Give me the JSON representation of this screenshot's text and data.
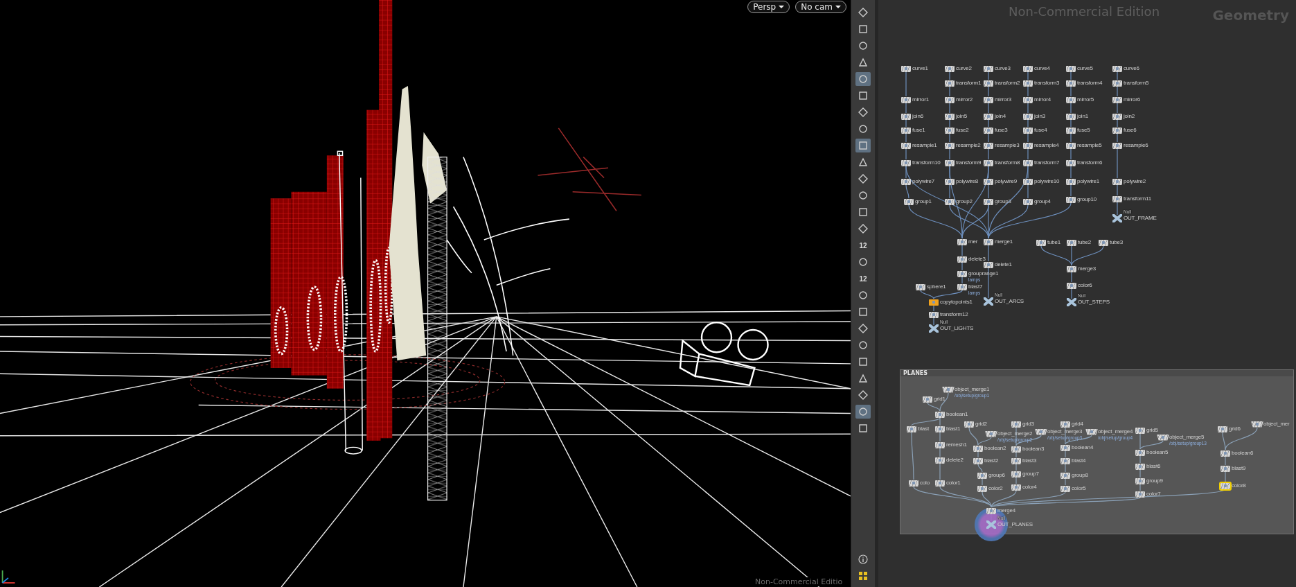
{
  "viewport": {
    "view_menu": "Persp",
    "camera_menu": "No cam",
    "edition_label": "Non-Commercial Editio"
  },
  "toolbar": {
    "tools": [
      {
        "selected": false
      },
      {
        "selected": false
      },
      {
        "selected": false
      },
      {
        "selected": false
      },
      {
        "selected": true
      },
      {
        "selected": false
      },
      {
        "selected": false
      },
      {
        "selected": false
      },
      {
        "selected": true
      },
      {
        "selected": false
      },
      {
        "selected": false
      },
      {
        "selected": false
      },
      {
        "selected": false
      },
      {
        "selected": false
      },
      {
        "selected": false,
        "label": "12"
      },
      {
        "selected": false
      },
      {
        "selected": false,
        "label": "12"
      },
      {
        "selected": false
      },
      {
        "selected": false
      },
      {
        "selected": false
      },
      {
        "selected": false
      },
      {
        "selected": false
      },
      {
        "selected": false
      },
      {
        "selected": false
      },
      {
        "selected": true
      },
      {
        "selected": false
      }
    ],
    "footer_tools": [
      {
        "selected": false
      },
      {
        "selected": false
      }
    ]
  },
  "network": {
    "edition_label": "Non-Commercial Edition",
    "context_label": "Geometry",
    "nodes": [
      {
        "label": "curve1",
        "kind": "sop",
        "selected": false,
        "display": false
      },
      {
        "label": "curve2",
        "kind": "sop",
        "selected": false,
        "display": false
      },
      {
        "label": "curve3",
        "kind": "sop",
        "selected": false,
        "display": false
      },
      {
        "label": "curve4",
        "kind": "sop",
        "selected": false,
        "display": false
      },
      {
        "label": "curve5",
        "kind": "sop",
        "selected": false,
        "display": false
      },
      {
        "label": "curve6",
        "kind": "sop",
        "selected": false,
        "display": false
      },
      {
        "label": "transform1",
        "kind": "sop",
        "selected": false,
        "display": false
      },
      {
        "label": "transform2",
        "kind": "sop",
        "selected": false,
        "display": false
      },
      {
        "label": "transform3",
        "kind": "sop",
        "selected": false,
        "display": false
      },
      {
        "label": "transform4",
        "kind": "sop",
        "selected": false,
        "display": false
      },
      {
        "label": "transform5",
        "kind": "sop",
        "selected": false,
        "display": false
      },
      {
        "label": "mirror1",
        "kind": "sop",
        "selected": false,
        "display": false
      },
      {
        "label": "mirror2",
        "kind": "sop",
        "selected": false,
        "display": false
      },
      {
        "label": "mirror3",
        "kind": "sop",
        "selected": false,
        "display": false
      },
      {
        "label": "mirror4",
        "kind": "sop",
        "selected": false,
        "display": false
      },
      {
        "label": "mirror5",
        "kind": "sop",
        "selected": false,
        "display": false
      },
      {
        "label": "mirror6",
        "kind": "sop",
        "selected": false,
        "display": false
      },
      {
        "label": "join6",
        "kind": "sop",
        "selected": false,
        "display": false
      },
      {
        "label": "join5",
        "kind": "sop",
        "selected": false,
        "display": false
      },
      {
        "label": "join4",
        "kind": "sop",
        "selected": false,
        "display": false
      },
      {
        "label": "join3",
        "kind": "sop",
        "selected": false,
        "display": false
      },
      {
        "label": "join1",
        "kind": "sop",
        "selected": false,
        "display": false
      },
      {
        "label": "join2",
        "kind": "sop",
        "selected": false,
        "display": false
      },
      {
        "label": "fuse1",
        "kind": "sop",
        "selected": false,
        "display": false
      },
      {
        "label": "fuse2",
        "kind": "sop",
        "selected": false,
        "display": false
      },
      {
        "label": "fuse3",
        "kind": "sop",
        "selected": false,
        "display": false
      },
      {
        "label": "fuse4",
        "kind": "sop",
        "selected": false,
        "display": false
      },
      {
        "label": "fuse5",
        "kind": "sop",
        "selected": false,
        "display": false
      },
      {
        "label": "fuse6",
        "kind": "sop",
        "selected": false,
        "display": false
      },
      {
        "label": "resample1",
        "kind": "sop",
        "selected": false,
        "display": false
      },
      {
        "label": "resample2",
        "kind": "sop",
        "selected": false,
        "display": false
      },
      {
        "label": "resample3",
        "kind": "sop",
        "selected": false,
        "display": false
      },
      {
        "label": "resample4",
        "kind": "sop",
        "selected": false,
        "display": false
      },
      {
        "label": "resample5",
        "kind": "sop",
        "selected": false,
        "display": false
      },
      {
        "label": "resample6",
        "kind": "sop",
        "selected": false,
        "display": false
      },
      {
        "label": "transform10",
        "kind": "sop",
        "selected": false,
        "display": false
      },
      {
        "label": "transform9",
        "kind": "sop",
        "selected": false,
        "display": false
      },
      {
        "label": "transform8",
        "kind": "sop",
        "selected": false,
        "display": false
      },
      {
        "label": "transform7",
        "kind": "sop",
        "selected": false,
        "display": false
      },
      {
        "label": "transform6",
        "kind": "sop",
        "selected": false,
        "display": false
      },
      {
        "label": "polywire7",
        "kind": "sop",
        "selected": false,
        "display": false
      },
      {
        "label": "polywire8",
        "kind": "sop",
        "selected": false,
        "display": false
      },
      {
        "label": "polywire9",
        "kind": "sop",
        "selected": false,
        "display": false
      },
      {
        "label": "polywire10",
        "kind": "sop",
        "selected": false,
        "display": false
      },
      {
        "label": "polywire1",
        "kind": "sop",
        "selected": false,
        "display": false
      },
      {
        "label": "polywire2",
        "kind": "sop",
        "selected": false,
        "display": false
      },
      {
        "label": "group1",
        "kind": "sop",
        "selected": false,
        "display": false
      },
      {
        "label": "group2",
        "kind": "sop",
        "selected": false,
        "display": false
      },
      {
        "label": "group3",
        "kind": "sop",
        "selected": false,
        "display": false
      },
      {
        "label": "group4",
        "kind": "sop",
        "selected": false,
        "display": false
      },
      {
        "label": "group10",
        "kind": "sop",
        "selected": false,
        "display": false
      },
      {
        "label": "transform11",
        "kind": "sop",
        "selected": false,
        "display": false
      },
      {
        "label": "OUT_FRAME",
        "kind": "null",
        "type_label": "Null",
        "selected": false,
        "display": false
      },
      {
        "label": "mer",
        "kind": "sop",
        "selected": false,
        "display": false
      },
      {
        "label": "merge1",
        "kind": "sop",
        "selected": false,
        "display": false
      },
      {
        "label": "delete3",
        "kind": "sop",
        "selected": false,
        "display": false
      },
      {
        "label": "delete1",
        "kind": "sop",
        "selected": false,
        "display": false
      },
      {
        "label": "grouprange1",
        "kind": "sop",
        "sublabel": "lamps",
        "selected": false,
        "display": false
      },
      {
        "label": "sphere1",
        "kind": "sop",
        "selected": false,
        "display": false
      },
      {
        "label": "blast7",
        "kind": "sop",
        "sublabel": "lamps",
        "selected": false,
        "display": false
      },
      {
        "label": "copytopoints1",
        "kind": "sop",
        "color": "#f0a21e",
        "selected": false,
        "display": false
      },
      {
        "label": "transform12",
        "kind": "sop",
        "selected": false,
        "display": false
      },
      {
        "label": "OUT_LIGHTS",
        "kind": "null",
        "type_label": "Null",
        "selected": false,
        "display": false
      },
      {
        "label": "OUT_ARCS",
        "kind": "null",
        "type_label": "Null",
        "selected": false,
        "display": false
      },
      {
        "label": "tube1",
        "kind": "sop",
        "selected": false,
        "display": false
      },
      {
        "label": "tube2",
        "kind": "sop",
        "selected": false,
        "display": false
      },
      {
        "label": "tube3",
        "kind": "sop",
        "selected": false,
        "display": false
      },
      {
        "label": "merge3",
        "kind": "sop",
        "selected": false,
        "display": false
      },
      {
        "label": "color6",
        "kind": "sop",
        "selected": false,
        "display": false
      },
      {
        "label": "OUT_STEPS",
        "kind": "null",
        "type_label": "Null",
        "selected": false,
        "display": false
      }
    ],
    "box": {
      "title": "PLANES",
      "nodes": [
        {
          "label": "object_merge1",
          "kind": "object_merge",
          "sublabel": "/obj/setup/group1",
          "selected": false,
          "display": false
        },
        {
          "label": "grid1",
          "kind": "sop",
          "selected": false,
          "display": false
        },
        {
          "label": "boolean1",
          "kind": "sop",
          "selected": false,
          "display": false
        },
        {
          "label": "blast",
          "kind": "sop",
          "selected": false,
          "display": false
        },
        {
          "label": "blast1",
          "kind": "sop",
          "selected": false,
          "display": false
        },
        {
          "label": "remesh1",
          "kind": "sop",
          "selected": false,
          "display": false
        },
        {
          "label": "delete2",
          "kind": "sop",
          "selected": false,
          "display": false
        },
        {
          "label": "colo",
          "kind": "sop",
          "selected": false,
          "display": false
        },
        {
          "label": "color1",
          "kind": "sop",
          "selected": false,
          "display": false
        },
        {
          "label": "grid2",
          "kind": "sop",
          "selected": false,
          "display": false
        },
        {
          "label": "object_merge2",
          "kind": "object_merge",
          "sublabel": "/obj/setup/group2",
          "selected": false,
          "display": false
        },
        {
          "label": "boolean2",
          "kind": "sop",
          "selected": false,
          "display": false
        },
        {
          "label": "blast2",
          "kind": "sop",
          "selected": false,
          "display": false
        },
        {
          "label": "group6",
          "kind": "sop",
          "selected": false,
          "display": false
        },
        {
          "label": "color2",
          "kind": "sop",
          "selected": false,
          "display": false
        },
        {
          "label": "grid3",
          "kind": "sop",
          "selected": false,
          "display": false
        },
        {
          "label": "object_merge3",
          "kind": "object_merge",
          "sublabel": "/obj/setup/group3",
          "selected": false,
          "display": false
        },
        {
          "label": "boolean3",
          "kind": "sop",
          "selected": false,
          "display": false
        },
        {
          "label": "blast3",
          "kind": "sop",
          "selected": false,
          "display": false
        },
        {
          "label": "group7",
          "kind": "sop",
          "selected": false,
          "display": false
        },
        {
          "label": "color4",
          "kind": "sop",
          "selected": false,
          "display": false
        },
        {
          "label": "grid4",
          "kind": "sop",
          "selected": false,
          "display": false
        },
        {
          "label": "object_merge4",
          "kind": "object_merge",
          "sublabel": "/obj/setup/group4",
          "selected": false,
          "display": false
        },
        {
          "label": "boolean4",
          "kind": "sop",
          "selected": false,
          "display": false
        },
        {
          "label": "blast4",
          "kind": "sop",
          "selected": false,
          "display": false
        },
        {
          "label": "group8",
          "kind": "sop",
          "selected": false,
          "display": false
        },
        {
          "label": "color5",
          "kind": "sop",
          "selected": false,
          "display": false
        },
        {
          "label": "grid5",
          "kind": "sop",
          "selected": false,
          "display": false
        },
        {
          "label": "object_merge5",
          "kind": "object_merge",
          "sublabel": "/obj/setup/group13",
          "selected": false,
          "display": false
        },
        {
          "label": "boolean5",
          "kind": "sop",
          "selected": false,
          "display": false
        },
        {
          "label": "blast6",
          "kind": "sop",
          "selected": false,
          "display": false
        },
        {
          "label": "group9",
          "kind": "sop",
          "selected": false,
          "display": false
        },
        {
          "label": "color7",
          "kind": "sop",
          "selected": false,
          "display": false
        },
        {
          "label": "grid6",
          "kind": "sop",
          "selected": false,
          "display": false
        },
        {
          "label": "object_mer",
          "kind": "object_merge",
          "selected": false,
          "display": false
        },
        {
          "label": "boolean6",
          "kind": "sop",
          "selected": false,
          "display": false
        },
        {
          "label": "blast9",
          "kind": "sop",
          "selected": false,
          "display": false
        },
        {
          "label": "color8",
          "kind": "sop",
          "selected": true,
          "display": false
        },
        {
          "label": "merge4",
          "kind": "sop",
          "selected": false,
          "display": false
        },
        {
          "label": "OUT_PLANES",
          "kind": "null",
          "type_label": "Null",
          "selected": false,
          "display": true
        }
      ]
    }
  }
}
